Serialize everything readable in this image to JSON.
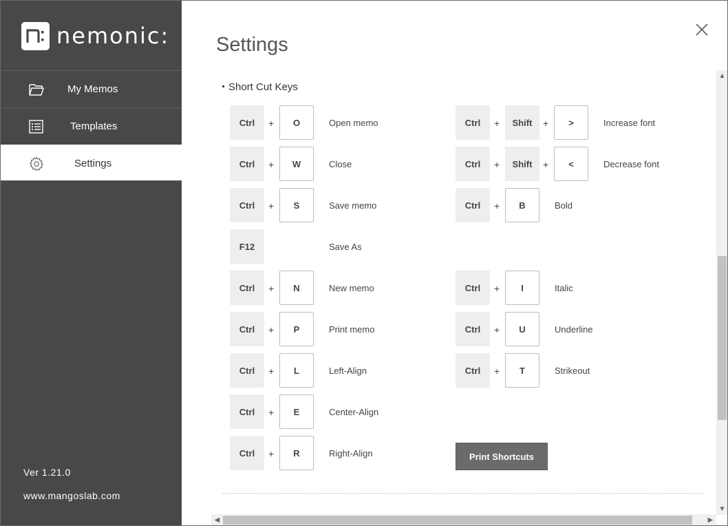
{
  "app": {
    "logo_text": "nemonic:"
  },
  "sidebar": {
    "items": [
      {
        "label": "My Memos",
        "icon": "folder-icon"
      },
      {
        "label": "Templates",
        "icon": "list-icon"
      },
      {
        "label": "Settings",
        "icon": "gear-icon",
        "active": true
      }
    ],
    "version": "Ver 1.21.0",
    "website": "www.mangoslab.com"
  },
  "page": {
    "title": "Settings",
    "section_title": "Short Cut Keys",
    "print_button": "Print Shortcuts"
  },
  "shortcuts": {
    "left": [
      {
        "keys": [
          "Ctrl",
          "O"
        ],
        "desc": "Open memo"
      },
      {
        "keys": [
          "Ctrl",
          "W"
        ],
        "desc": "Close"
      },
      {
        "keys": [
          "Ctrl",
          "S"
        ],
        "desc": "Save memo"
      },
      {
        "keys": [
          "F12"
        ],
        "desc": "Save As"
      },
      {
        "keys": [
          "Ctrl",
          "N"
        ],
        "desc": "New memo"
      },
      {
        "keys": [
          "Ctrl",
          "P"
        ],
        "desc": "Print memo"
      },
      {
        "keys": [
          "Ctrl",
          "L"
        ],
        "desc": "Left-Align"
      },
      {
        "keys": [
          "Ctrl",
          "E"
        ],
        "desc": "Center-Align"
      },
      {
        "keys": [
          "Ctrl",
          "R"
        ],
        "desc": "Right-Align"
      }
    ],
    "right": [
      {
        "keys": [
          "Ctrl",
          "Shift",
          ">"
        ],
        "desc": "Increase font"
      },
      {
        "keys": [
          "Ctrl",
          "Shift",
          "<"
        ],
        "desc": "Decrease font"
      },
      {
        "keys": [
          "Ctrl",
          "B"
        ],
        "desc": "Bold"
      },
      {
        "keys": [
          "Ctrl",
          "I"
        ],
        "desc": "Italic"
      },
      {
        "keys": [
          "Ctrl",
          "U"
        ],
        "desc": "Underline"
      },
      {
        "keys": [
          "Ctrl",
          "T"
        ],
        "desc": "Strikeout"
      }
    ],
    "plus_sign": "+"
  },
  "colors": {
    "sidebar_bg": "#484848",
    "button_bg": "#6b6b6b",
    "modifier_key_bg": "#eeeeee"
  }
}
